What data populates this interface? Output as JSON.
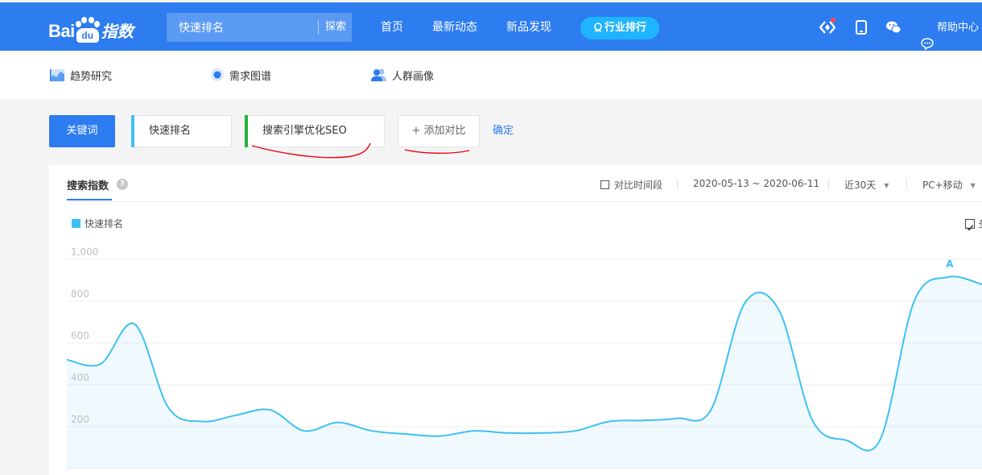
{
  "header": {
    "logo_text": "Bai",
    "logo_du": "du",
    "logo_suffix": "指数",
    "search": {
      "value": "快速排名",
      "button": "探索"
    },
    "nav": [
      "首页",
      "最新动态",
      "新品发现"
    ],
    "nav_pill": "行业排行",
    "help": "帮助中心",
    "icons": [
      "diamond-icon",
      "phone-icon",
      "wechat-icon",
      "chat-bubble-icon"
    ],
    "accent_color": "#2d7cf0",
    "pill_color": "#1fb4ff"
  },
  "subnav": {
    "items": [
      {
        "label": "趋势研究",
        "icon": "trend-chart-icon"
      },
      {
        "label": "需求图谱",
        "icon": "demand-graph-icon"
      },
      {
        "label": "人群画像",
        "icon": "people-icon"
      }
    ]
  },
  "keywords": {
    "label": "关键词",
    "items": [
      {
        "text": "快速排名",
        "color": "#3ec1f0"
      },
      {
        "text": "搜索引擎优化SEO",
        "color": "#22b33a"
      }
    ],
    "add_label": "+ 添加对比",
    "confirm": "确定"
  },
  "panel": {
    "tab": "搜索指数",
    "help_mark": "?",
    "compare_period": "对比时间段",
    "date_range": "2020-05-13 ~ 2020-06-11",
    "period": "近30天",
    "device": "PC+移动",
    "legend": "快速排名",
    "right_checkbox_label": "多"
  },
  "chart_data": {
    "type": "area",
    "ytick_labels": [
      "1,000",
      "800",
      "600",
      "400",
      "200"
    ],
    "ylim": [
      0,
      1000
    ],
    "grid": true,
    "annotation": "A",
    "series": [
      {
        "name": "快速排名",
        "color": "#3ec1f0",
        "values": [
          520,
          500,
          690,
          290,
          225,
          255,
          280,
          180,
          220,
          180,
          165,
          155,
          180,
          170,
          170,
          180,
          225,
          230,
          240,
          280,
          790,
          760,
          230,
          135,
          140,
          800,
          915,
          880
        ]
      }
    ]
  }
}
